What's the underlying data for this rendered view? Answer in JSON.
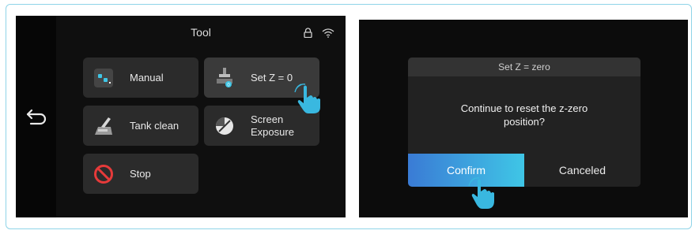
{
  "left_screen": {
    "title": "Tool",
    "status_icons": [
      "lock-icon",
      "wifi-icon"
    ],
    "back_icon": "return-arrow-icon",
    "tiles": [
      {
        "label": "Manual",
        "icon": "manual-icon"
      },
      {
        "label": "Set Z = 0",
        "icon": "set-z-icon"
      },
      {
        "label": "Tank clean",
        "icon": "tank-clean-icon"
      },
      {
        "label": "Screen Exposure",
        "icon": "screen-exposure-icon"
      },
      {
        "label": "Stop",
        "icon": "stop-icon"
      }
    ]
  },
  "right_screen": {
    "dialog": {
      "title": "Set Z = zero",
      "message": "Continue to reset the z-zero position?",
      "confirm_label": "Confirm",
      "cancel_label": "Canceled"
    }
  },
  "colors": {
    "frame_border": "#8fd4e8",
    "accent_gradient_start": "#3a7bd5",
    "accent_gradient_end": "#3fc6e6",
    "tap_hand": "#39b8e0",
    "stop_red": "#e63a3a"
  }
}
